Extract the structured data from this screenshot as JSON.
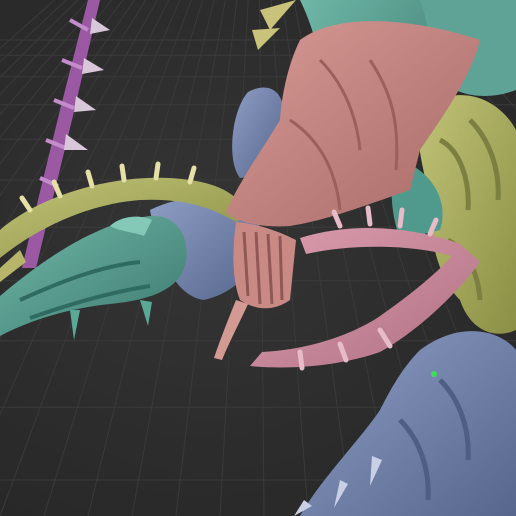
{
  "viewport": {
    "background_color": "#2b2b2b",
    "grid_color": "#3a3a3a",
    "grid_visible": true
  },
  "model_parts": [
    {
      "name": "purple-tail-spine",
      "color": "#a05aa8"
    },
    {
      "name": "yellow-tentacle",
      "color": "#c8c27a"
    },
    {
      "name": "teal-claw-arm",
      "color": "#4f9a8c"
    },
    {
      "name": "blue-body-segment",
      "color": "#6c7fa6"
    },
    {
      "name": "pink-head-carapace",
      "color": "#c98a86"
    },
    {
      "name": "mauve-mandible-blade",
      "color": "#c9889c"
    },
    {
      "name": "olive-torso-plate",
      "color": "#a6ad5e"
    },
    {
      "name": "blue-leg-segment",
      "color": "#7a88b8"
    }
  ],
  "markers": [
    {
      "name": "selection-point",
      "color": "#3ddc5a"
    }
  ]
}
